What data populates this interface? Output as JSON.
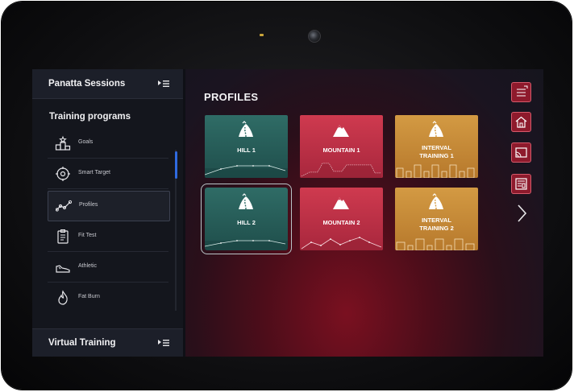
{
  "sidebar": {
    "header_title": "Panatta Sessions",
    "section_title": "Training programs",
    "items": [
      {
        "label": "Goals",
        "icon": "podium-icon"
      },
      {
        "label": "Smart Target",
        "icon": "target-icon"
      },
      {
        "label": "Profiles",
        "icon": "profile-graph-icon",
        "active": true
      },
      {
        "label": "Fit Test",
        "icon": "clipboard-icon"
      },
      {
        "label": "Athletic",
        "icon": "shoe-icon"
      },
      {
        "label": "Fat Burn",
        "icon": "flame-icon"
      }
    ],
    "footer_title": "Virtual Training"
  },
  "main": {
    "title": "PROFILES",
    "cards": [
      {
        "label": "HILL 1",
        "style": "green",
        "icon": "hill-road-icon"
      },
      {
        "label": "MOUNTAIN 1",
        "style": "red",
        "icon": "mountain-icon"
      },
      {
        "label": "INTERVAL TRAINING 1",
        "style": "gold",
        "icon": "hill-road-icon"
      },
      {
        "label": "HILL 2",
        "style": "green",
        "icon": "hill-road-icon",
        "selected": true
      },
      {
        "label": "MOUNTAIN 2",
        "style": "red",
        "icon": "mountain-icon"
      },
      {
        "label": "INTERVAL TRAINING 2",
        "style": "gold",
        "icon": "hill-road-icon"
      }
    ]
  },
  "rail": {
    "buttons": [
      "menu-icon",
      "home-icon",
      "cast-icon",
      "book-icon",
      "next-page-icon"
    ]
  },
  "colors": {
    "green_card": "#2f6c66",
    "red_card": "#cf3a4f",
    "gold_card": "#d39a43",
    "accent_blue": "#2f6ae0",
    "rail_button": "#8e1a2c"
  }
}
